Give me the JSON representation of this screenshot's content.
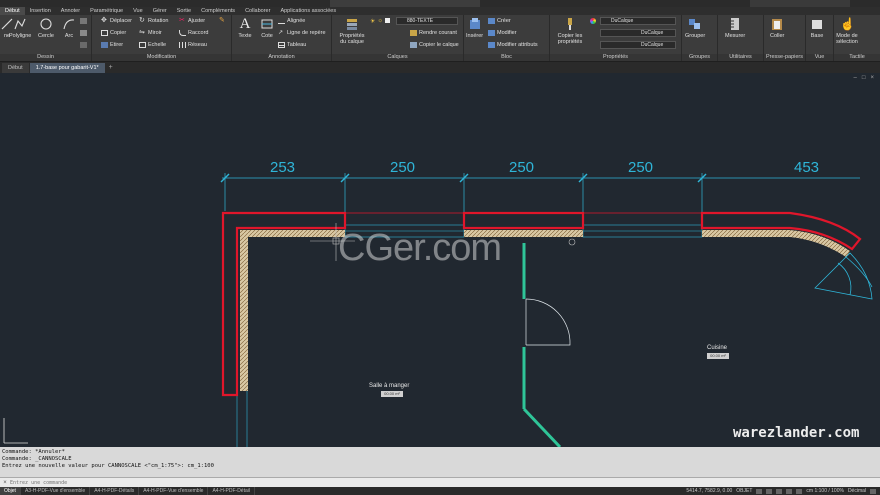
{
  "ribbon_tabs": [
    "Début",
    "Insertion",
    "Annoter",
    "Paramétrique",
    "Vue",
    "Gérer",
    "Sortie",
    "Compléments",
    "Collaborer",
    "Applications associées"
  ],
  "ribbon": {
    "dessin": {
      "label": "Dessin",
      "ligne": "ne",
      "polyligne": "Polyligne",
      "cercle": "Cercle",
      "arc": "Arc"
    },
    "modification": {
      "label": "Modification",
      "deplacer": "Déplacer",
      "rotation": "Rotation",
      "ajuster": "Ajuster",
      "copier": "Copier",
      "miroir": "Miroir",
      "raccord": "Raccord",
      "etirer": "Etirer",
      "echelle": "Echelle",
      "reseau": "Réseau"
    },
    "annotation": {
      "label": "Annotation",
      "texte": "Texte",
      "cote": "Cote",
      "alignee": "Alignée",
      "ligne_repere": "Ligne de repère",
      "tableau": "Tableau"
    },
    "calques": {
      "label": "Calques",
      "proprietes": "Propriétés du calque",
      "layer_value": "880-TEXTE",
      "rendre_courant": "Rendre courant",
      "copier_calque": "Copier le calque"
    },
    "bloc": {
      "label": "Bloc",
      "inserer": "Insérer",
      "creer": "Créer",
      "modifier": "Modifier",
      "modifier_attributs": "Modifier attributs"
    },
    "proprietes": {
      "label": "Propriétés",
      "copier_props": "Copier les propriétés",
      "color_value": "DuCalque",
      "linetype_value": "DuCalque",
      "lineweight_value": "DuCalque"
    },
    "groupes": {
      "label": "Groupes",
      "grouper": "Grouper"
    },
    "utilitaires": {
      "label": "Utilitaires",
      "mesurer": "Mesurer"
    },
    "presse_papiers": {
      "label": "Presse-papiers",
      "coller": "Coller"
    },
    "vue": {
      "label": "Vue",
      "base": "Base"
    },
    "tactile": {
      "label": "Tactile",
      "mode_selection": "Mode de sélection"
    }
  },
  "file_tabs": [
    {
      "label": "Début",
      "active": false
    },
    {
      "label": "1.7-base pour gabarit-V1*",
      "active": true
    }
  ],
  "file_tab_add": "+",
  "drawing": {
    "dimensions": [
      "253",
      "250",
      "250",
      "250",
      "453"
    ],
    "rooms": [
      {
        "name": "Salle à manger",
        "tag": "00.00 m²"
      },
      {
        "name": "Cuisine",
        "tag": "00.00 m²"
      }
    ],
    "window_controls": [
      "–",
      "□",
      "×"
    ],
    "watermark_cger": "CGer.com",
    "watermark_warez": "warezlander.com"
  },
  "command": {
    "history": [
      "Commande: *Annuler*",
      "Commande: _CANNOSCALE",
      "Entrez une nouvelle valeur pour CANNOSCALE <\"cm_1:75\">: cm_1:100"
    ],
    "placeholder": "Entrez une commande",
    "close_glyph": "×"
  },
  "layout_tabs": [
    {
      "label": "Objet",
      "active": true
    },
    {
      "label": "A3-H-PDF-Vue d'ensemble",
      "active": false
    },
    {
      "label": "A4-H-PDF-Détails",
      "active": false
    },
    {
      "label": "A4-H-PDF-Vue d'ensemble",
      "active": false
    },
    {
      "label": "A4-H-PDF-Détail",
      "active": false
    }
  ],
  "status": {
    "coords": "5414.7, 7582.9, 0.00",
    "objet": "OBJET",
    "scale": "cm 1:100 / 100%",
    "units": "Décimal"
  },
  "colors": {
    "wall_red": "#e0162b",
    "hatch": "#d9c8a4",
    "dim_cyan": "#2fb5d8",
    "green_wall": "#2fc598",
    "canvas_bg": "#212830"
  }
}
